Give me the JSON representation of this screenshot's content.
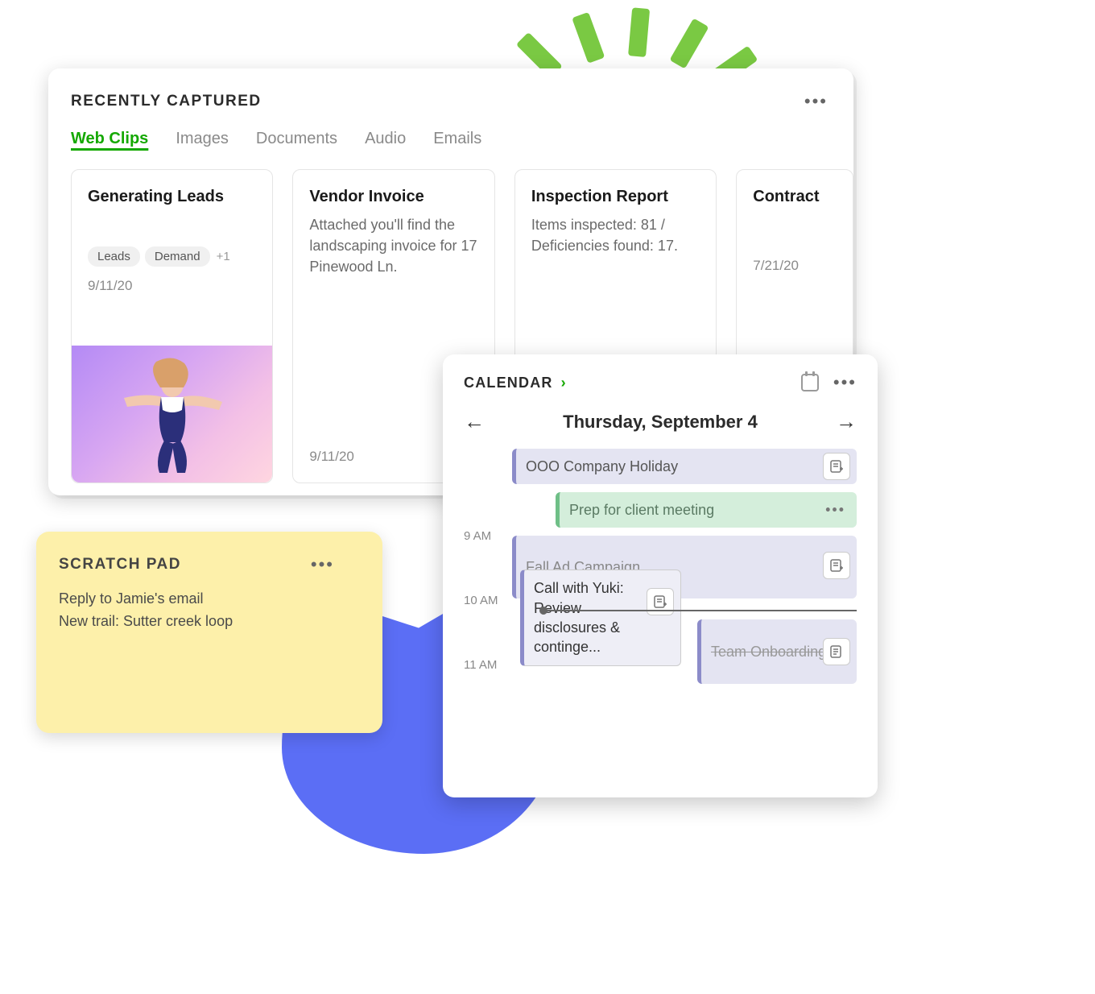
{
  "recent": {
    "title": "RECENTLY CAPTURED",
    "tabs": [
      "Web Clips",
      "Images",
      "Documents",
      "Audio",
      "Emails"
    ],
    "active_tab": 0,
    "cards": [
      {
        "title": "Generating Leads",
        "snippet": "",
        "chips": [
          "Leads",
          "Demand"
        ],
        "chips_more": "+1",
        "date": "9/11/20",
        "image": "dancer"
      },
      {
        "title": "Vendor Invoice",
        "snippet": "Attached you'll find the landscaping invoice for 17 Pinewood Ln.",
        "chips": [],
        "chips_more": "",
        "date": "9/11/20",
        "image": null
      },
      {
        "title": "Inspection Report",
        "snippet": "Items inspected: 81 / Deficiencies found: 17.",
        "chips": [],
        "chips_more": "",
        "date": "",
        "image": null
      },
      {
        "title": "Contract",
        "snippet": "",
        "chips": [],
        "chips_more": "",
        "date": "7/21/20",
        "image": null
      }
    ]
  },
  "scratch": {
    "title": "SCRATCH PAD",
    "lines": [
      "Reply to Jamie's email",
      "New trail: Sutter creek loop"
    ]
  },
  "calendar": {
    "title": "CALENDAR",
    "date_label": "Thursday, September 4",
    "time_labels": [
      "9 AM",
      "10 AM",
      "11 AM"
    ],
    "events": [
      {
        "label": "OOO Company Holiday",
        "color": "lavender",
        "has_note_btn": true
      },
      {
        "label": "Prep for client meeting",
        "color": "green",
        "has_dots": true
      },
      {
        "label": "Fall Ad Campaign",
        "color": "lavender",
        "has_note_btn": true
      },
      {
        "label": "Call with Yuki: Review disclosures & continge...",
        "color": "lavender-light",
        "has_note_btn": true
      },
      {
        "label": "Team Onboarding",
        "color": "lavender",
        "strike": true,
        "has_note_btn": true
      }
    ]
  }
}
